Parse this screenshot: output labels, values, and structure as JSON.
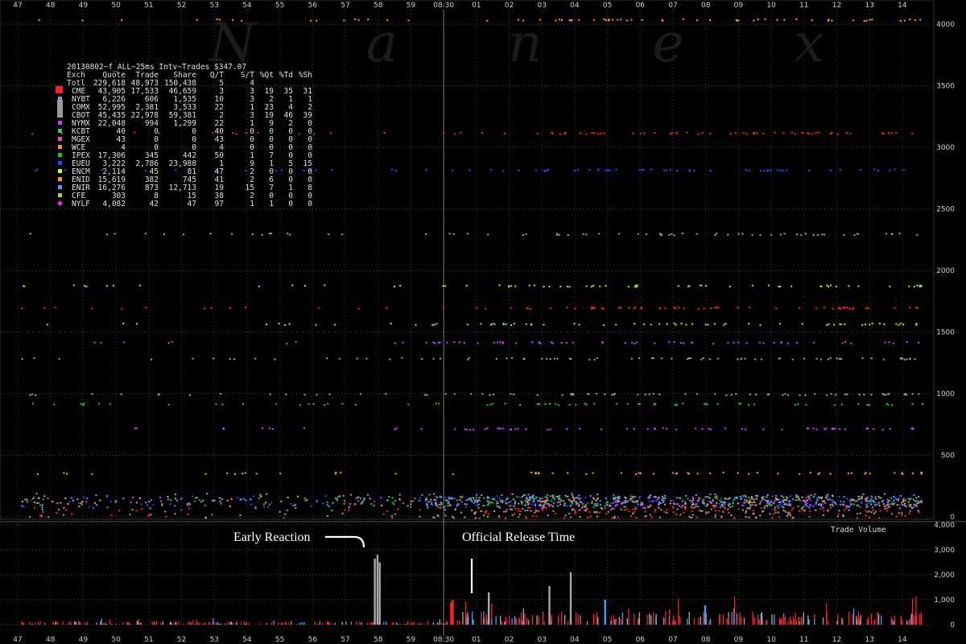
{
  "chart_data": [
    {
      "type": "scatter",
      "title": "20130802~f_ALL~25ms Intv~Trades $347.07",
      "watermark": "N a n e x",
      "x_ticks": [
        "47",
        "48",
        "49",
        "50",
        "51",
        "52",
        "53",
        "54",
        "55",
        "56",
        "57",
        "58",
        "59",
        "08:30",
        "01",
        "02",
        "03",
        "04",
        "05",
        "06",
        "07",
        "08",
        "09",
        "10",
        "11",
        "12",
        "13",
        "14"
      ],
      "xlim_minutes": [
        -13.0,
        14.7
      ],
      "y_ticks": [
        "0",
        "500",
        "1000",
        "1500",
        "2000",
        "2500",
        "3000",
        "3500",
        "4000"
      ],
      "ylim": [
        0,
        4000
      ],
      "stats_table": {
        "columns": [
          "Exch",
          "Quote",
          "Trade",
          "Share",
          "Q/T",
          "S/T",
          "%Qt",
          "%Td",
          "%Sh"
        ],
        "rows": [
          {
            "exch": "Totl",
            "quote": "229,618",
            "trade": "48,973",
            "share": "150,438",
            "qt": "5",
            "st": "4",
            "pqt": "",
            "ptd": "",
            "psh": "",
            "color": "",
            "marker": "none"
          },
          {
            "exch": "CME",
            "quote": "43,905",
            "trade": "17,533",
            "share": "46,659",
            "qt": "3",
            "st": "3",
            "pqt": "19",
            "ptd": "35",
            "psh": "31",
            "color": "#ff2020",
            "marker": "big-square"
          },
          {
            "exch": "NYBT",
            "quote": "6,226",
            "trade": "606",
            "share": "1,535",
            "qt": "10",
            "st": "3",
            "pqt": "2",
            "ptd": "1",
            "psh": "1",
            "color": "#9a9a9a",
            "marker": "square"
          },
          {
            "exch": "COMX",
            "quote": "52,995",
            "trade": "2,381",
            "share": "3,533",
            "qt": "22",
            "st": "1",
            "pqt": "23",
            "ptd": "4",
            "psh": "2",
            "color": "#9a9a9a",
            "marker": "tall"
          },
          {
            "exch": "CBOT",
            "quote": "45,435",
            "trade": "22,978",
            "share": "59,381",
            "qt": "2",
            "st": "3",
            "pqt": "19",
            "ptd": "46",
            "psh": "39",
            "color": "#9a9a9a",
            "marker": "tall"
          },
          {
            "exch": "NYMX",
            "quote": "22,048",
            "trade": "994",
            "share": "1,299",
            "qt": "22",
            "st": "1",
            "pqt": "9",
            "ptd": "2",
            "psh": "0",
            "color": "#c040ff",
            "marker": "square"
          },
          {
            "exch": "KCBT",
            "quote": "40",
            "trade": "0",
            "share": "0",
            "qt": "40",
            "st": "0",
            "pqt": "0",
            "ptd": "0",
            "psh": "0",
            "color": "#20d060",
            "marker": "square"
          },
          {
            "exch": "MGEX",
            "quote": "43",
            "trade": "0",
            "share": "0",
            "qt": "43",
            "st": "0",
            "pqt": "0",
            "ptd": "0",
            "psh": "0",
            "color": "#ff40c0",
            "marker": "square"
          },
          {
            "exch": "WCE",
            "quote": "4",
            "trade": "0",
            "share": "0",
            "qt": "4",
            "st": "0",
            "pqt": "0",
            "ptd": "0",
            "psh": "0",
            "color": "#ff9020",
            "marker": "square"
          },
          {
            "exch": "IPEX",
            "quote": "17,306",
            "trade": "345",
            "share": "442",
            "qt": "50",
            "st": "1",
            "pqt": "7",
            "ptd": "0",
            "psh": "0",
            "color": "#20c020",
            "marker": "square"
          },
          {
            "exch": "EUEU",
            "quote": "3,222",
            "trade": "2,786",
            "share": "23,988",
            "qt": "1",
            "st": "9",
            "pqt": "1",
            "ptd": "5",
            "psh": "15",
            "color": "#3040ff",
            "marker": "square"
          },
          {
            "exch": "ENCM",
            "quote": "2,114",
            "trade": "45",
            "share": "81",
            "qt": "47",
            "st": "2",
            "pqt": "0",
            "ptd": "0",
            "psh": "0",
            "color": "#c0ff30",
            "marker": "square"
          },
          {
            "exch": "ENID",
            "quote": "15,619",
            "trade": "382",
            "share": "745",
            "qt": "41",
            "st": "2",
            "pqt": "6",
            "ptd": "0",
            "psh": "0",
            "color": "#ff9030",
            "marker": "square"
          },
          {
            "exch": "ENIR",
            "quote": "16,276",
            "trade": "873",
            "share": "12,713",
            "qt": "19",
            "st": "15",
            "pqt": "7",
            "ptd": "1",
            "psh": "8",
            "color": "#40a0ff",
            "marker": "square"
          },
          {
            "exch": "CFE",
            "quote": "303",
            "trade": "8",
            "share": "15",
            "qt": "38",
            "st": "2",
            "pqt": "0",
            "ptd": "0",
            "psh": "0",
            "color": "#a0e020",
            "marker": "square"
          },
          {
            "exch": "NYLF",
            "quote": "4,082",
            "trade": "42",
            "share": "47",
            "qt": "97",
            "st": "1",
            "pqt": "1",
            "ptd": "0",
            "psh": "0",
            "color": "#e030c0",
            "marker": "diamond"
          }
        ]
      },
      "series": [
        {
          "name": "CME",
          "color": "#ff2020",
          "levels": [
            1700,
            3120,
            40
          ],
          "dense_after": 0.9
        },
        {
          "name": "NYBT",
          "color": "#9a9a9a",
          "levels": [
            1290,
            2300,
            1000,
            40,
            150
          ],
          "dense_after": -0.6
        },
        {
          "name": "EUEU",
          "color": "#3040ff",
          "levels": [
            2820,
            130
          ],
          "dense_after": 0.7
        },
        {
          "name": "ENID",
          "color": "#ff9030",
          "levels": [
            4040,
            360,
            130
          ],
          "dense_after": 2.5
        },
        {
          "name": "NYMX",
          "color": "#c040ff",
          "levels": [
            1420,
            720,
            120
          ],
          "dense_after": -0.6
        },
        {
          "name": "IPEX",
          "color": "#20c020",
          "levels": [
            920,
            130
          ],
          "dense_after": -0.6
        },
        {
          "name": "CFE",
          "color": "#a0e020",
          "levels": [
            1570,
            1880
          ],
          "dense_after": 0.6
        },
        {
          "name": "ENIR",
          "color": "#40a0ff",
          "levels": [
            140
          ],
          "dense_after": -0.6
        }
      ]
    },
    {
      "type": "bar",
      "title": "Trade Volume",
      "y_ticks": [
        "0",
        "1,000",
        "2,000",
        "3,000",
        "4,000"
      ],
      "ylim": [
        0,
        4000
      ],
      "spikes": [
        {
          "x_minute": -2.13,
          "value": 2650,
          "color": "#a8a8a8"
        },
        {
          "x_minute": -2.05,
          "value": 2800,
          "color": "#a8a8a8"
        },
        {
          "x_minute": -1.98,
          "value": 2500,
          "color": "#a8a8a8"
        },
        {
          "x_minute": 0.2,
          "value": 900,
          "color": "#ff2020"
        },
        {
          "x_minute": 0.25,
          "value": 1000,
          "color": "#ff2020"
        },
        {
          "x_minute": 1.35,
          "value": 1300,
          "color": "#a8a8a8"
        },
        {
          "x_minute": 3.2,
          "value": 1550,
          "color": "#a8a8a8"
        },
        {
          "x_minute": 3.85,
          "value": 2100,
          "color": "#a8a8a8"
        },
        {
          "x_minute": 4.9,
          "value": 1000,
          "color": "#40a0ff"
        },
        {
          "x_minute": 7.95,
          "value": 780,
          "color": "#40a0ff"
        }
      ],
      "annotations": [
        {
          "text": "Early Reaction",
          "x_minute": -2.1
        },
        {
          "text": "Official Release Time",
          "x_minute": 0.1
        }
      ]
    }
  ]
}
